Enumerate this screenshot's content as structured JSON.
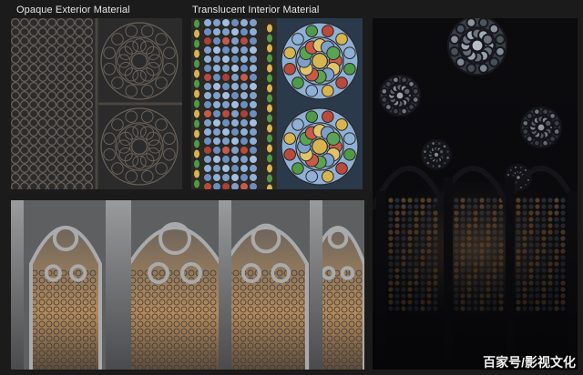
{
  "labels": {
    "opaque": "Opaque Exterior Material",
    "translucent": "Translucent Interior Material"
  },
  "watermark": "百家号/影视文化",
  "colors": {
    "background": "#1b1b1b",
    "opaque_lead": "#6b6259",
    "opaque_bg": "#2b2b2b",
    "glass_blue": "#7d9fc9",
    "glass_green": "#4f9a47",
    "glass_red": "#b94a3c",
    "glass_yellow": "#d8b450",
    "stone": "#8b8c8d",
    "night_bg": "#0b0b0e",
    "warm_glow": "#c7955b"
  },
  "images": [
    "opaque-exterior-window-texture",
    "translucent-stained-glass-texture",
    "cathedral-interior-night-render",
    "gothic-arcade-exterior-render"
  ]
}
